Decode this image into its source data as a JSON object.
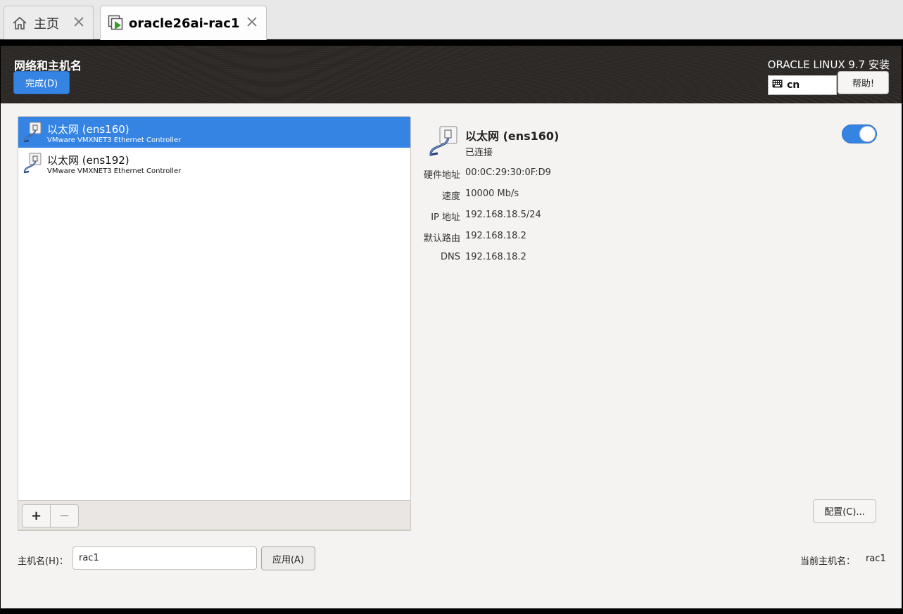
{
  "browser_tabs": [
    {
      "label": "主页",
      "icon": "home-icon"
    },
    {
      "label": "oracle26ai-rac1",
      "icon": "vm-console-icon"
    }
  ],
  "header": {
    "spoke_title": "网络和主机名",
    "done_label": "完成(D)",
    "product": "ORACLE LINUX 9.7 安装",
    "keyboard_layout": "cn",
    "help_label": "帮助!"
  },
  "devices": [
    {
      "name": "以太网 (ens160)",
      "description": "VMware VMXNET3 Ethernet Controller",
      "selected": true
    },
    {
      "name": "以太网 (ens192)",
      "description": "VMware VMXNET3 Ethernet Controller",
      "selected": false
    }
  ],
  "list_toolbar": {
    "add_label": "+",
    "remove_label": "−"
  },
  "details": {
    "name": "以太网 (ens160)",
    "status": "已连接",
    "enabled": true,
    "properties": [
      {
        "label": "硬件地址",
        "value": "00:0C:29:30:0F:D9"
      },
      {
        "label": "速度",
        "value": "10000 Mb/s"
      },
      {
        "label": "IP 地址",
        "value": "192.168.18.5/24"
      },
      {
        "label": "默认路由",
        "value": "192.168.18.2"
      },
      {
        "label": "DNS",
        "value": "192.168.18.2"
      }
    ],
    "configure_label": "配置(C)..."
  },
  "hostname": {
    "label": "主机名(H)：",
    "value": "rac1",
    "apply_label": "应用(A)",
    "current_label": "当前主机名：",
    "current_value": "rac1"
  },
  "colors": {
    "accent": "#3584e4",
    "header_bg": "#2b2826",
    "window_bg": "#f4f3f2"
  }
}
